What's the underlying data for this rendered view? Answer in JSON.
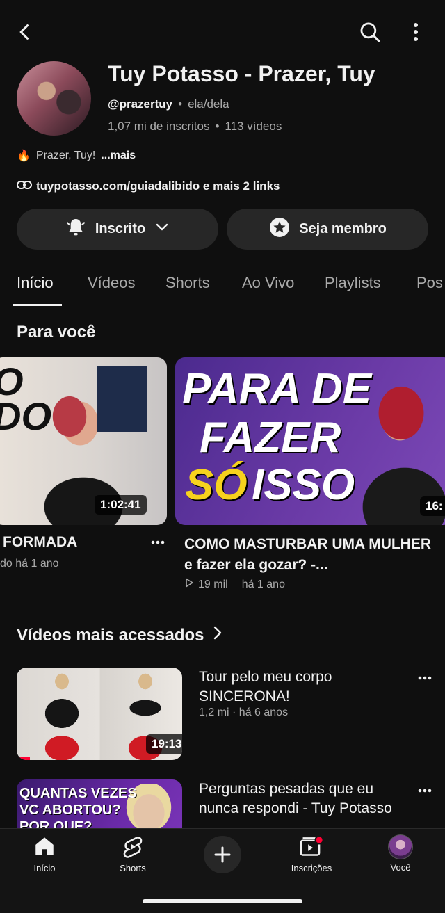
{
  "channel": {
    "name": "Tuy Potasso - Prazer, Tuy",
    "handle": "@prazertuy",
    "pronouns": "ela/dela",
    "subscribers": "1,07 mi de inscritos",
    "videos": "113 vídeos",
    "description_emoji": "🔥",
    "description": "Prazer, Tuy!",
    "description_more": "...mais",
    "links": "tuypotasso.com/guiadalibido e mais 2 links"
  },
  "actions": {
    "subscribe_label": "Inscrito",
    "join_label": "Seja membro"
  },
  "tabs": [
    "Início",
    "Vídeos",
    "Shorts",
    "Ao Vivo",
    "Playlists",
    "Pos"
  ],
  "for_you": {
    "title": "Para você",
    "cards": [
      {
        "thumb_text": "O\nDO",
        "duration": "1:02:41",
        "title": "FORMADA",
        "meta": "do há 1 ano"
      },
      {
        "thumb_line1": "PARA DE",
        "thumb_line2": "FAZER",
        "thumb_line3a": "SÓ",
        "thumb_line3b": "ISSO",
        "duration": "16:",
        "title": "COMO MASTURBAR UMA MULHER e fazer ela gozar? -...",
        "views": "19 mil",
        "age": "há 1 ano"
      }
    ]
  },
  "popular": {
    "title": "Vídeos mais acessados",
    "rows": [
      {
        "duration": "19:13",
        "title": "Tour pelo meu corpo SINCERONA!",
        "meta": "1,2 mi · há 6 anos",
        "watched_fraction": 0.08
      },
      {
        "thumb_text": "QUANTAS VEZES\nVC ABORTOU?\nPOR QUE?",
        "title": "Perguntas pesadas que eu nunca respondi - Tuy Potasso"
      }
    ]
  },
  "nav": {
    "home": "Início",
    "shorts": "Shorts",
    "subscriptions": "Inscrições",
    "you": "Você"
  },
  "colors": {
    "background": "#0f0f0f",
    "surface": "#272727",
    "accent_red": "#ff0033",
    "thumb_yellow": "#f7d21d"
  }
}
